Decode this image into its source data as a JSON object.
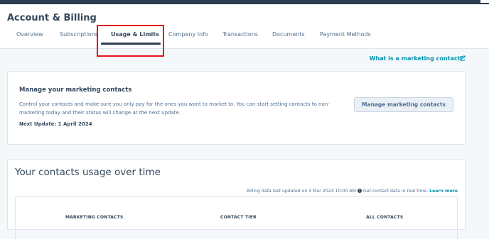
{
  "page": {
    "title": "Account & Billing"
  },
  "tabs": [
    {
      "label": "Overview",
      "active": false
    },
    {
      "label": "Subscriptions",
      "active": false
    },
    {
      "label": "Usage & Limits",
      "active": true
    },
    {
      "label": "Company Info",
      "active": false
    },
    {
      "label": "Transactions",
      "active": false
    },
    {
      "label": "Documents",
      "active": false
    },
    {
      "label": "Payment Methods",
      "active": false
    }
  ],
  "help_link": {
    "label": "What is a marketing contact?",
    "icon": "external-link-icon"
  },
  "marketing_card": {
    "title": "Manage your marketing contacts",
    "description": "Control your contacts and make sure you only pay for the ones you want to market to. You can start setting contacts to non-marketing today and their status will change at the next update.",
    "next_update": "Next Update: 1 April 2024",
    "button_label": "Manage marketing contacts"
  },
  "usage_card": {
    "title": "Your contacts usage over time",
    "billing_note": "Billing data last updated on 4 Mar 2024 10:00 AM",
    "realtime_note": "Get contact data in real time.",
    "learn_more": "Learn more",
    "columns": [
      "MARKETING CONTACTS",
      "CONTACT TIER",
      "ALL CONTACTS"
    ]
  },
  "colors": {
    "accent": "#0091ae",
    "highlight": "#e8131b",
    "nav_dark": "#2d3e50"
  }
}
